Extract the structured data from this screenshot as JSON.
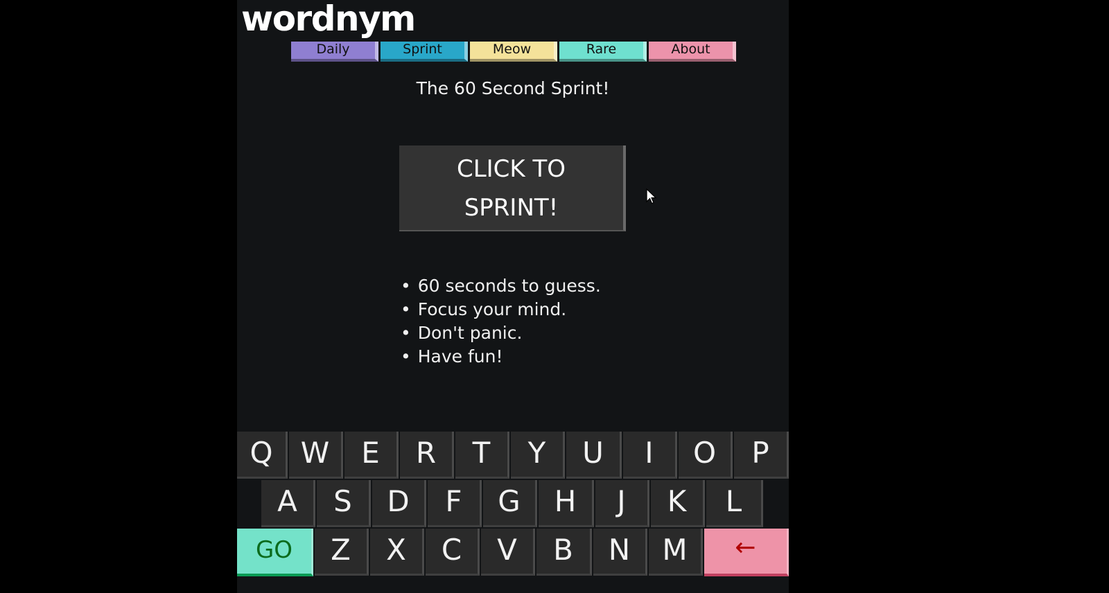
{
  "app": {
    "logo_text": "wordnym"
  },
  "tabs": [
    {
      "label": "Daily",
      "color": "#8f7fd1"
    },
    {
      "label": "Sprint",
      "color": "#29a7c9"
    },
    {
      "label": "Meow",
      "color": "#f4e29a"
    },
    {
      "label": "Rare",
      "color": "#6fe0cf"
    },
    {
      "label": "About",
      "color": "#ec93ab"
    }
  ],
  "main": {
    "title": "The 60 Second Sprint!",
    "sprint_button": {
      "line1": "CLICK TO",
      "line2": "SPRINT!"
    },
    "rules": [
      "60 seconds to guess.",
      "Focus your mind.",
      "Don't panic.",
      "Have fun!"
    ]
  },
  "keyboard": {
    "row1": [
      "Q",
      "W",
      "E",
      "R",
      "T",
      "Y",
      "U",
      "I",
      "O",
      "P"
    ],
    "row2": [
      "A",
      "S",
      "D",
      "F",
      "G",
      "H",
      "J",
      "K",
      "L"
    ],
    "row3": [
      "Z",
      "X",
      "C",
      "V",
      "B",
      "N",
      "M"
    ],
    "go_label": "GO",
    "backspace_label": "←"
  }
}
